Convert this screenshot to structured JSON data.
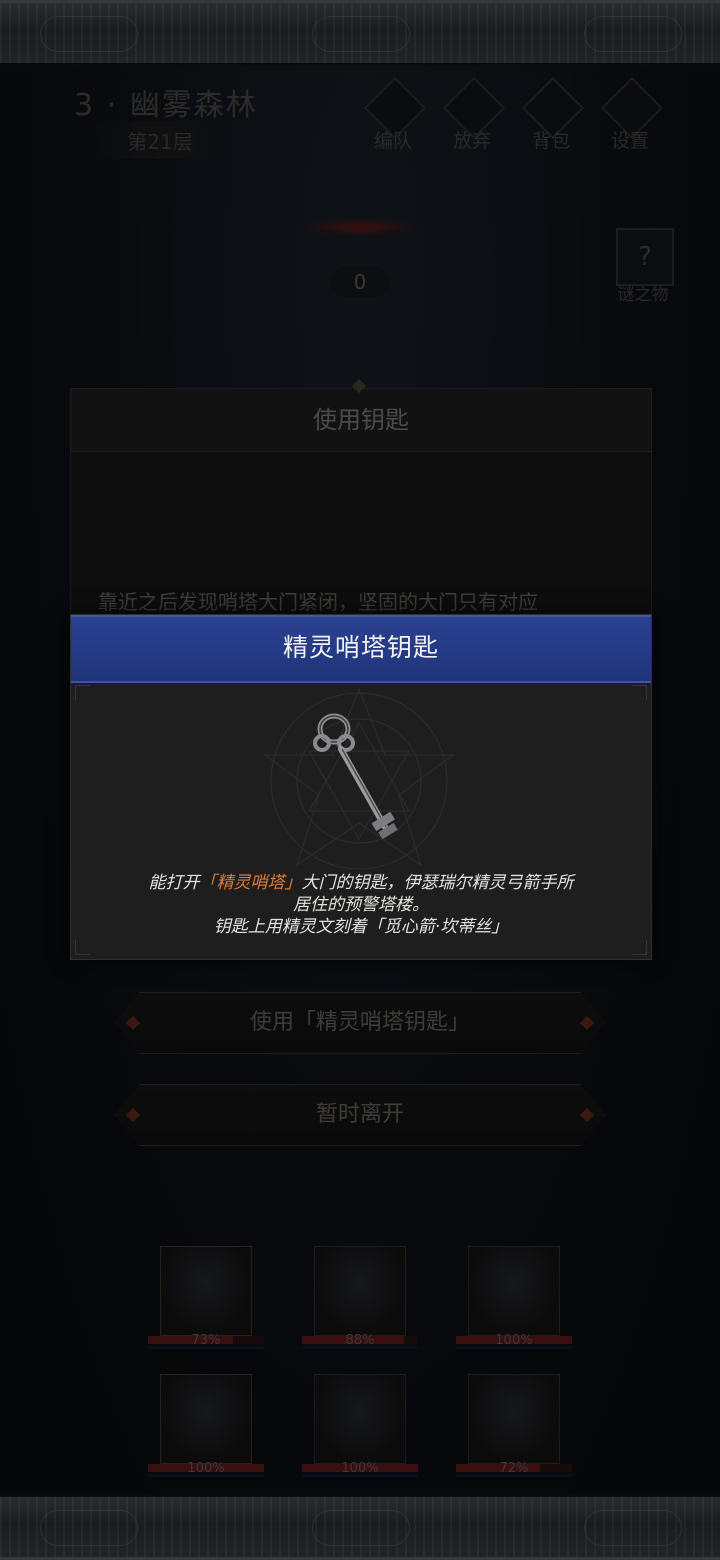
{
  "stage": {
    "title": "3 · 幽雾森林",
    "floor": "第21层"
  },
  "top_buttons": [
    {
      "label": "编队"
    },
    {
      "label": "放弃"
    },
    {
      "label": "背包"
    },
    {
      "label": "设置"
    }
  ],
  "mystery": {
    "icon": "?",
    "label": "谜之物"
  },
  "score": "0",
  "event": {
    "title": "使用钥匙",
    "text": "靠近之后发现哨塔大门紧闭，坚固的大门只有对应",
    "options": [
      {
        "label": "使用「精灵哨塔钥匙」"
      },
      {
        "label": "暂时离开"
      }
    ]
  },
  "item": {
    "name": "精灵哨塔钥匙",
    "desc_prefix": "能打开",
    "desc_highlight": "「精灵哨塔」",
    "desc_line1_rest": "大门的钥匙，伊瑟瑞尔精灵弓箭手所",
    "desc_line2": "居住的预警塔楼。",
    "desc_line3": "钥匙上用精灵文刻着「觅心箭·坎蒂丝」",
    "highlight_color": "#e07b32",
    "header_color": "#2b4191"
  },
  "heroes": [
    {
      "hp": "73%",
      "hp_value": 73
    },
    {
      "hp": "88%",
      "hp_value": 88
    },
    {
      "hp": "100%",
      "hp_value": 100
    },
    {
      "hp": "100%",
      "hp_value": 100
    },
    {
      "hp": "100%",
      "hp_value": 100
    },
    {
      "hp": "72%",
      "hp_value": 72
    }
  ]
}
